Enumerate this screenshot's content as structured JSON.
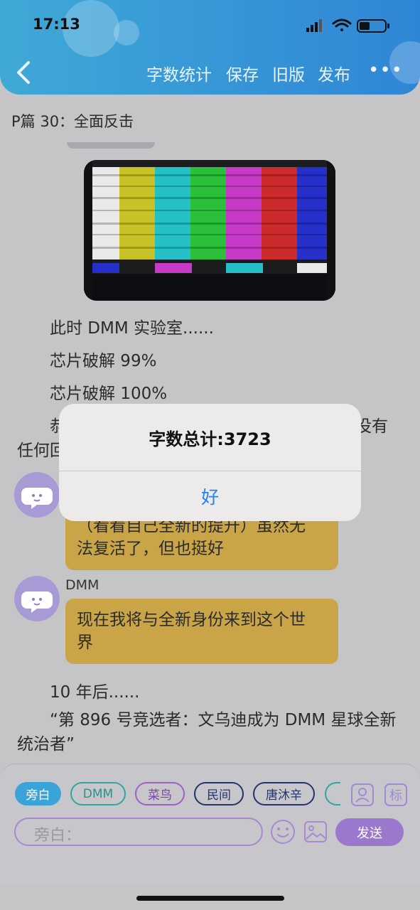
{
  "status_bar": {
    "time": "17:13"
  },
  "header": {
    "nav": [
      "字数统计",
      "保存",
      "旧版",
      "发布"
    ],
    "more": "•••"
  },
  "chapter_title": "P篇 30：全面反击",
  "story": {
    "line1": "此时 DMM 实验室......",
    "line2": "芯片破解 99%",
    "line3": "芯片破解 100%",
    "para_partial_start": "恭",
    "para_partial_end": "没有",
    "para_partial_line2": "任何回",
    "chat1_text_partial": "（看看自己全新的提升）虽然无法复活了，但也挺好",
    "chat2_speaker": "DMM",
    "chat2_text": "现在我将与全新身份来到这个世界",
    "line4": "10 年后......",
    "para2": "“第 896 号竞选者：文乌迪成为 DMM 星球全新统治者”"
  },
  "toolbar": {
    "chips": [
      "旁白",
      "DMM",
      "菜鸟",
      "民间",
      "唐沐辛"
    ],
    "mark_label": "标",
    "input_placeholder": "旁白：",
    "send_label": "发送"
  },
  "alert": {
    "title": "字数总计:3723",
    "ok_label": "好"
  },
  "colors": {
    "header": "#2f86d6",
    "bubble": "#c9a547",
    "accent_purple": "#9a78cd",
    "narration_chip": "#3aa3d8",
    "dmm_chip": "#2fa6a0",
    "alert_button": "#2a7ff0"
  }
}
